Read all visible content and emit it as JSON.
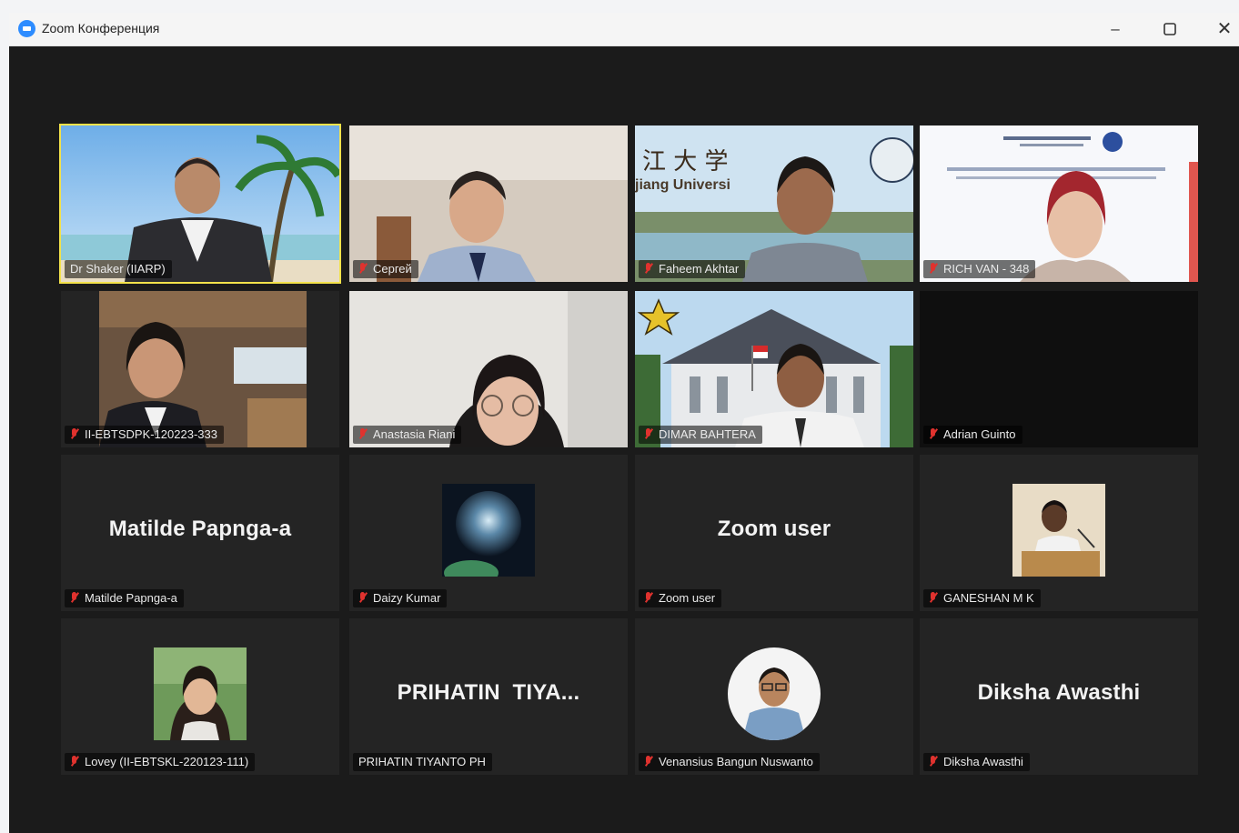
{
  "window": {
    "title": "Zoom Конференция",
    "minimize_icon": "minimize-icon",
    "maximize_icon": "maximize-icon",
    "close_icon": "close-icon"
  },
  "participants": [
    {
      "name": "Dr Shaker (IIARP)",
      "muted": false,
      "active_speaker": true,
      "video": true
    },
    {
      "name": "Сергей",
      "muted": true,
      "video": true
    },
    {
      "name": "Faheem Akhtar",
      "muted": true,
      "video": true,
      "background_text": "江大学 jiang Universi"
    },
    {
      "name": "RICH VAN - 348",
      "muted": true,
      "video": true
    },
    {
      "name": "II-EBTSDPK-120223-333",
      "muted": true,
      "video": true
    },
    {
      "name": "Anastasia Riani",
      "muted": true,
      "video": true
    },
    {
      "name": "DIMAR BAHTERA",
      "muted": true,
      "video": true
    },
    {
      "name": "Adrian Guinto",
      "muted": true,
      "video": false
    },
    {
      "name": "Matilde Papnga-a",
      "display": "Matilde Papnga-a",
      "muted": true,
      "video": false
    },
    {
      "name": "Daizy Kumar",
      "muted": true,
      "video": false,
      "picture": true
    },
    {
      "name": "Zoom user",
      "display": "Zoom user",
      "muted": true,
      "video": false
    },
    {
      "name": "GANESHAN M K",
      "muted": true,
      "video": false,
      "picture": true
    },
    {
      "name": "Lovey (II-EBTSKL-220123-111)",
      "muted": true,
      "video": false,
      "picture": true
    },
    {
      "name": "PRIHATIN TIYANTO PH",
      "display": "PRIHATIN  TIYA...",
      "muted": false,
      "video": false
    },
    {
      "name": "Venansius Bangun Nuswanto",
      "muted": true,
      "video": false,
      "picture": true
    },
    {
      "name": "Diksha Awasthi",
      "display": "Diksha Awasthi",
      "muted": true,
      "video": false
    }
  ],
  "colors": {
    "active_speaker_outline": "#f3e24a",
    "muted_icon": "#e0322e",
    "tile_background": "#242424",
    "meeting_background": "#1b1b1b"
  }
}
